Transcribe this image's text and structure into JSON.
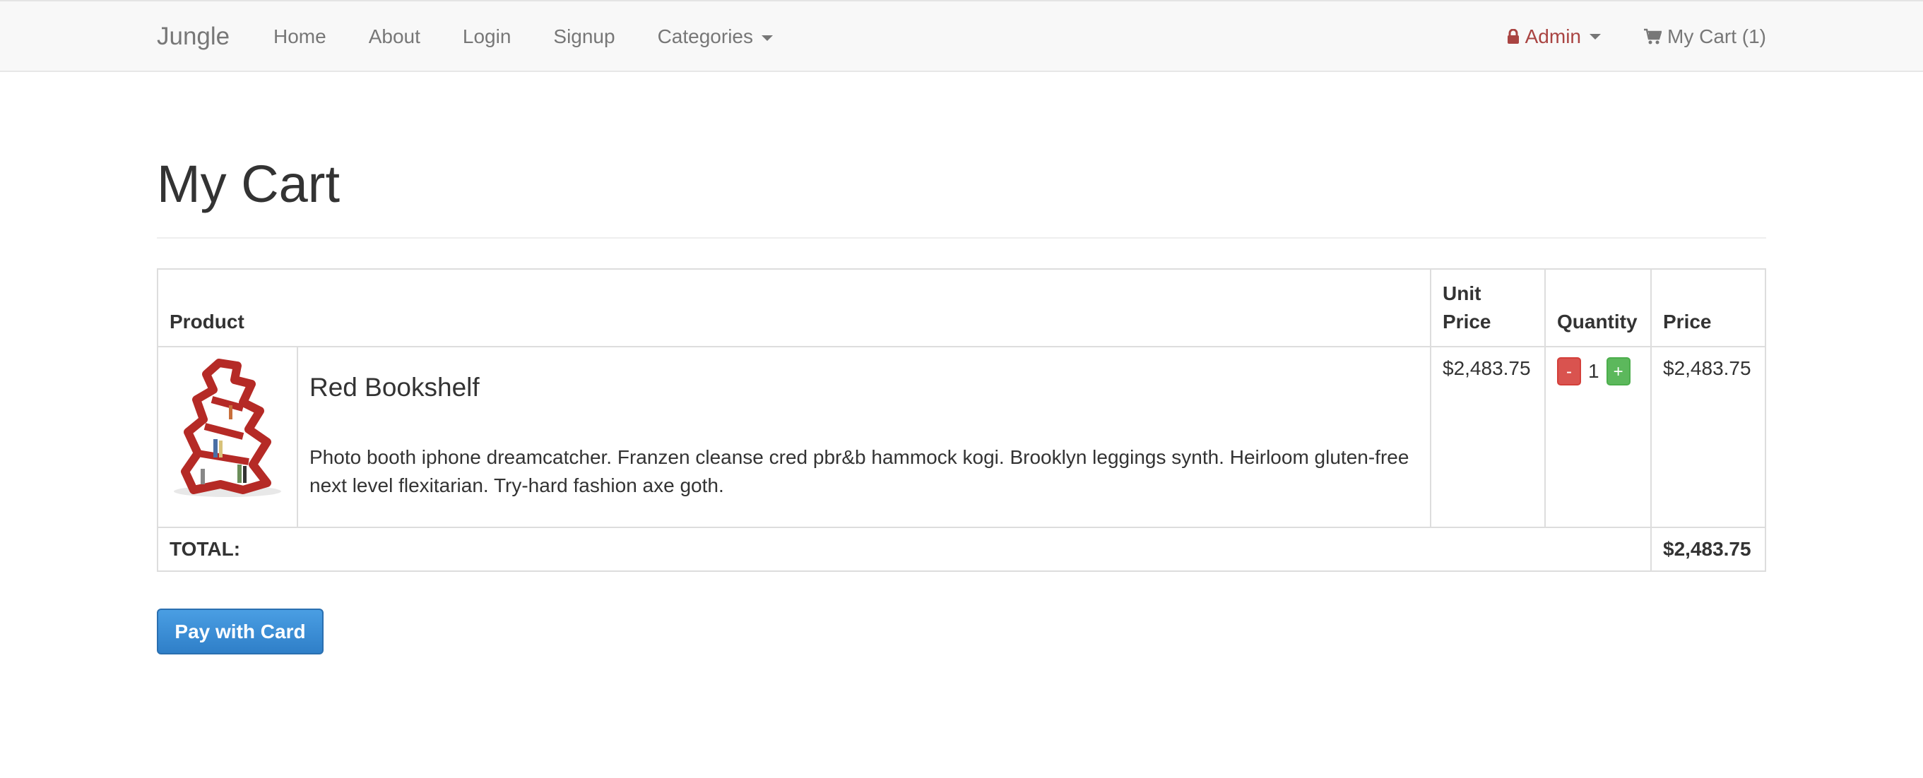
{
  "navbar": {
    "brand": "Jungle",
    "links": [
      "Home",
      "About",
      "Login",
      "Signup"
    ],
    "categories_label": "Categories",
    "admin_label": "Admin",
    "cart_label": "My Cart (1)"
  },
  "page": {
    "title": "My Cart"
  },
  "table": {
    "headers": {
      "product": "Product",
      "unit_price": "Unit Price",
      "quantity": "Quantity",
      "price": "Price"
    },
    "items": [
      {
        "name": "Red Bookshelf",
        "description": "Photo booth iphone dreamcatcher. Franzen cleanse cred pbr&b hammock kogi. Brooklyn leggings synth. Heirloom gluten-free next level flexitarian. Try-hard fashion axe goth.",
        "unit_price": "$2,483.75",
        "quantity": "1",
        "minus_label": "-",
        "plus_label": "+",
        "price": "$2,483.75"
      }
    ],
    "total_label": "TOTAL:",
    "total_value": "$2,483.75"
  },
  "checkout": {
    "pay_label": "Pay with Card"
  },
  "colors": {
    "admin": "#a94442",
    "pay_button": "#3a8fd8",
    "minus_button": "#d9534f",
    "plus_button": "#5cb85c"
  }
}
